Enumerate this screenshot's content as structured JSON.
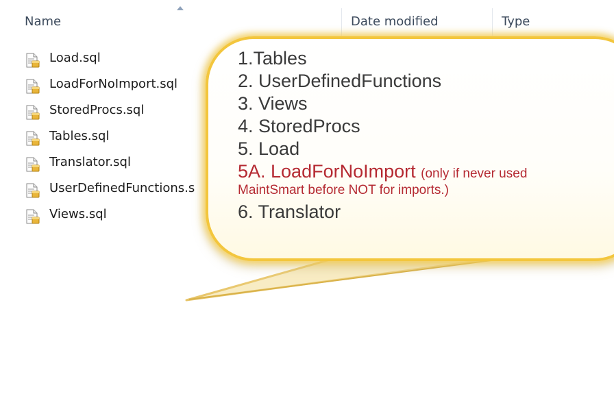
{
  "columns": {
    "name": "Name",
    "date_modified": "Date modified",
    "type": "Type"
  },
  "files": [
    {
      "name": "Load.sql"
    },
    {
      "name": "LoadForNoImport.sql"
    },
    {
      "name": "StoredProcs.sql"
    },
    {
      "name": "Tables.sql"
    },
    {
      "name": "Translator.sql"
    },
    {
      "name": "UserDefinedFunctions.s"
    },
    {
      "name": "Views.sql"
    }
  ],
  "callout": {
    "step1": "1.Tables",
    "step2": "2. UserDefinedFunctions",
    "step3": "3. Views",
    "step4": "4. StoredProcs",
    "step5": "5. Load",
    "step5a_label": "5A. LoadForNoImport",
    "step5a_note": "(only if never used",
    "step5a_note_line2": "MaintSmart before NOT for imports.)",
    "step6": "6. Translator"
  },
  "colors": {
    "callout_border": "#f3c63d",
    "highlight_red": "#b52a32",
    "header_text": "#3c4a5c"
  },
  "icons": {
    "file": "sql-file-icon",
    "sort": "sort-ascending-icon"
  }
}
